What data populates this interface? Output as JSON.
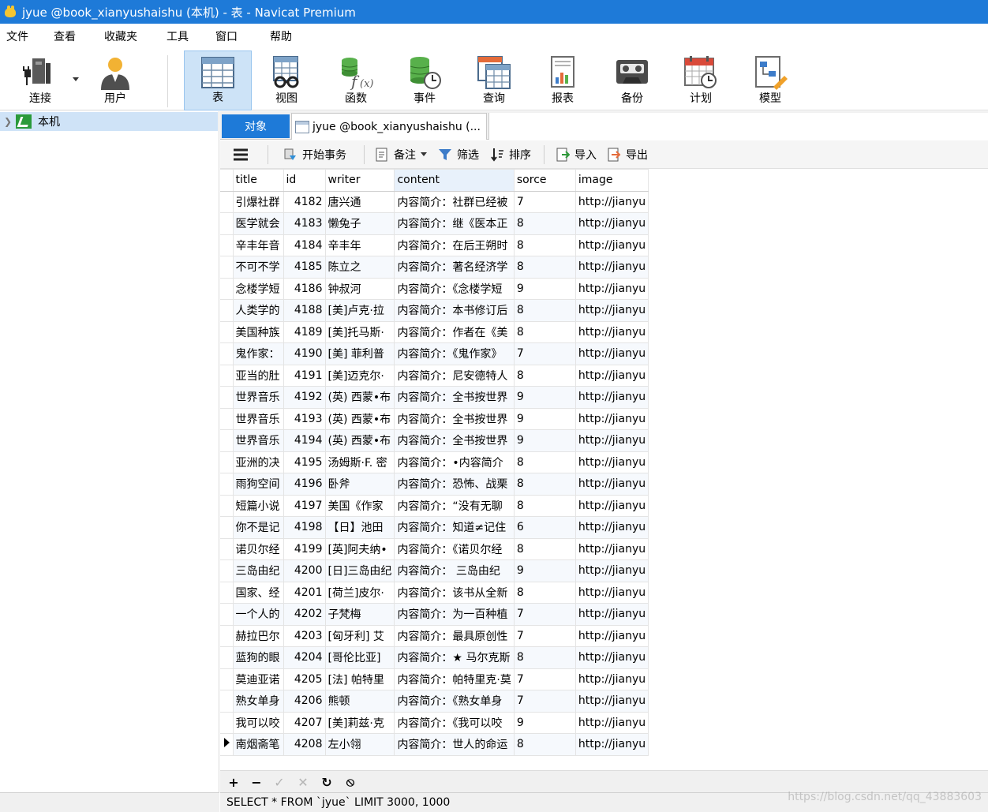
{
  "window": {
    "title": "jyue @book_xianyushaishu (本机) - 表 - Navicat Premium"
  },
  "menu": [
    "文件",
    "查看",
    "收藏夹",
    "工具",
    "窗口",
    "帮助"
  ],
  "toolbar": {
    "connect": "连接",
    "user": "用户",
    "table": "表",
    "view": "视图",
    "function": "函数",
    "event": "事件",
    "query": "查询",
    "report": "报表",
    "backup": "备份",
    "schedule": "计划",
    "model": "模型"
  },
  "tree": {
    "connection": "本机"
  },
  "tabs": {
    "objects": "对象",
    "table_tab": "jyue @book_xianyushaishu (..."
  },
  "gridtoolbar": {
    "begin_tx": "开始事务",
    "memo": "备注",
    "filter": "筛选",
    "sort": "排序",
    "import": "导入",
    "export": "导出"
  },
  "columns": [
    "title",
    "id",
    "writer",
    "content",
    "sorce",
    "image"
  ],
  "rows": [
    [
      "引爆社群",
      "4182",
      "唐兴通",
      "内容简介：社群已经被",
      "7",
      "http://jianyu"
    ],
    [
      "医学就会",
      "4183",
      "懒兔子",
      "内容简介：继《医本正",
      "8",
      "http://jianyu"
    ],
    [
      "辛丰年音",
      "4184",
      "辛丰年",
      "内容简介：在后王朔时",
      "8",
      "http://jianyu"
    ],
    [
      "不可不学",
      "4185",
      "陈立之",
      "内容简介：著名经济学",
      "8",
      "http://jianyu"
    ],
    [
      "念楼学短",
      "4186",
      "钟叔河",
      "内容简介：《念楼学短",
      "9",
      "http://jianyu"
    ],
    [
      "人类学的",
      "4188",
      "[美]卢克·拉",
      "内容简介：本书修订后",
      "8",
      "http://jianyu"
    ],
    [
      "美国种族",
      "4189",
      "[美]托马斯·",
      "内容简介：作者在《美",
      "8",
      "http://jianyu"
    ],
    [
      "鬼作家：",
      "4190",
      "[美] 菲利普",
      "内容简介：《鬼作家》",
      "7",
      "http://jianyu"
    ],
    [
      "亚当的肚",
      "4191",
      "[美]迈克尔·",
      "内容简介：尼安德特人",
      "8",
      "http://jianyu"
    ],
    [
      "世界音乐",
      "4192",
      "(英) 西蒙•布",
      "内容简介：全书按世界",
      "9",
      "http://jianyu"
    ],
    [
      "世界音乐",
      "4193",
      "(英) 西蒙•布",
      "内容简介：全书按世界",
      "9",
      "http://jianyu"
    ],
    [
      "世界音乐",
      "4194",
      "(英) 西蒙•布",
      "内容简介：全书按世界",
      "9",
      "http://jianyu"
    ],
    [
      "亚洲的决",
      "4195",
      "汤姆斯·F. 密",
      "内容简介：•内容简介",
      "8",
      "http://jianyu"
    ],
    [
      "雨狗空间",
      "4196",
      "卧斧",
      "内容简介：恐怖、战栗",
      "8",
      "http://jianyu"
    ],
    [
      "短篇小说",
      "4197",
      "美国《作家",
      "内容简介：“没有无聊",
      "8",
      "http://jianyu"
    ],
    [
      "你不是记",
      "4198",
      "【日】池田",
      "内容简介：知道≠记住",
      "6",
      "http://jianyu"
    ],
    [
      "诺贝尔经",
      "4199",
      "[英]阿夫纳•",
      "内容简介：《诺贝尔经",
      "8",
      "http://jianyu"
    ],
    [
      "三岛由纪",
      "4200",
      "[日]三岛由纪",
      "内容简介：  三岛由纪",
      "9",
      "http://jianyu"
    ],
    [
      "国家、经",
      "4201",
      "[荷兰]皮尔·",
      "内容简介：该书从全新",
      "8",
      "http://jianyu"
    ],
    [
      "一个人的",
      "4202",
      "子梵梅",
      "内容简介：为一百种植",
      "7",
      "http://jianyu"
    ],
    [
      "赫拉巴尔",
      "4203",
      "[匈牙利]  艾",
      "内容简介：最具原创性",
      "7",
      "http://jianyu"
    ],
    [
      "蓝狗的眼",
      "4204",
      "[哥伦比亚]",
      "内容简介：★ 马尔克斯",
      "8",
      "http://jianyu"
    ],
    [
      "莫迪亚诺",
      "4205",
      "[法] 帕特里",
      "内容简介：帕特里克·莫",
      "7",
      "http://jianyu"
    ],
    [
      "熟女单身",
      "4206",
      "熊顿",
      "内容简介：《熟女单身",
      "7",
      "http://jianyu"
    ],
    [
      "我可以咬",
      "4207",
      "[美]莉兹·克",
      "内容简介：《我可以咬",
      "9",
      "http://jianyu"
    ],
    [
      "南烟斋笔",
      "4208",
      "左小翎",
      "内容简介：世人的命运",
      "8",
      "http://jianyu"
    ]
  ],
  "status": {
    "sql": "SELECT * FROM `jyue` LIMIT 3000, 1000"
  },
  "watermark": "https://blog.csdn.net/qq_43883603"
}
